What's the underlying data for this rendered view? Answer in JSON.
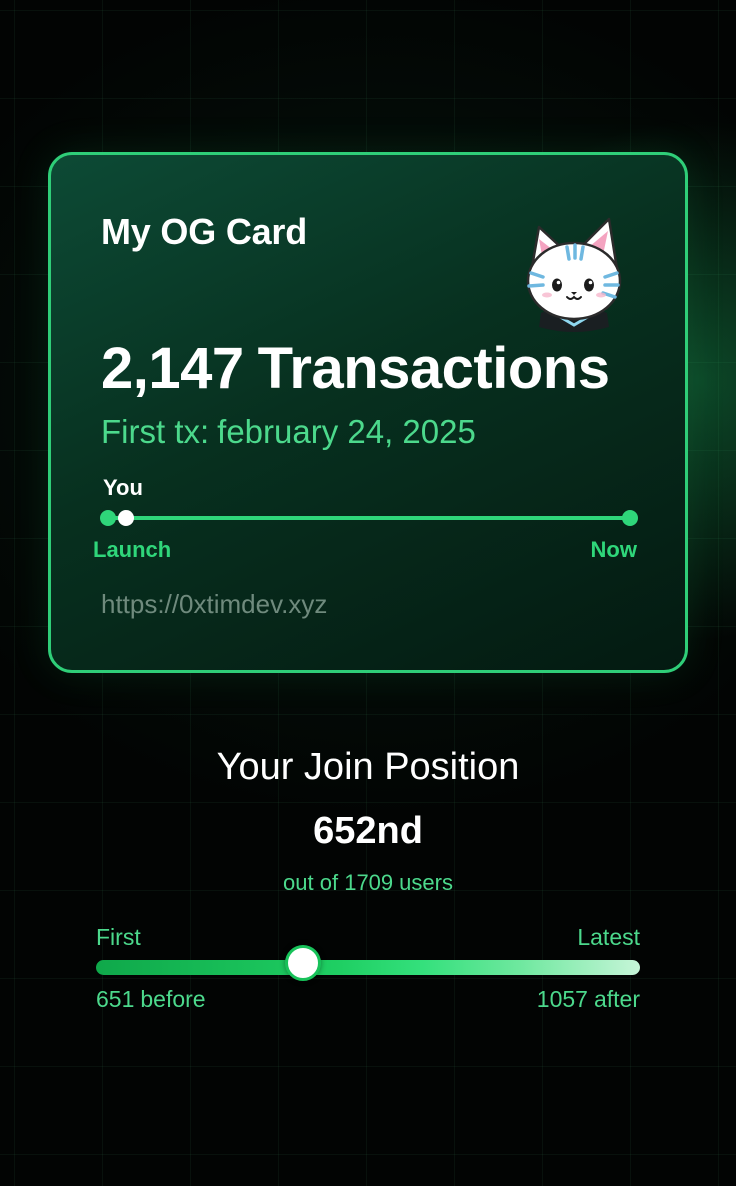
{
  "og_card": {
    "title": "My OG Card",
    "mascot_icon": "cat-avatar-icon",
    "tx_count": "2,147",
    "tx_label": "Transactions",
    "first_tx_label": "First tx:",
    "first_tx_date": "february 24, 2025",
    "timeline": {
      "you_label": "You",
      "start_label": "Launch",
      "end_label": "Now"
    },
    "url": "https://0xtimdev.xyz"
  },
  "join_position": {
    "title": "Your Join Position",
    "rank": "652nd",
    "total_prefix": "out of 1709",
    "total_suffix": "users",
    "first_label": "First",
    "latest_label": "Latest",
    "before_count": "651",
    "before_suffix": "before",
    "after_count": "1057",
    "after_suffix": "after",
    "position_fraction": 0.38
  },
  "colors": {
    "accent": "#2fd67a",
    "accent_text": "#4cd98c",
    "card_border": "#2fce78",
    "background": "#020403",
    "url_text": "#6f8a7d"
  }
}
